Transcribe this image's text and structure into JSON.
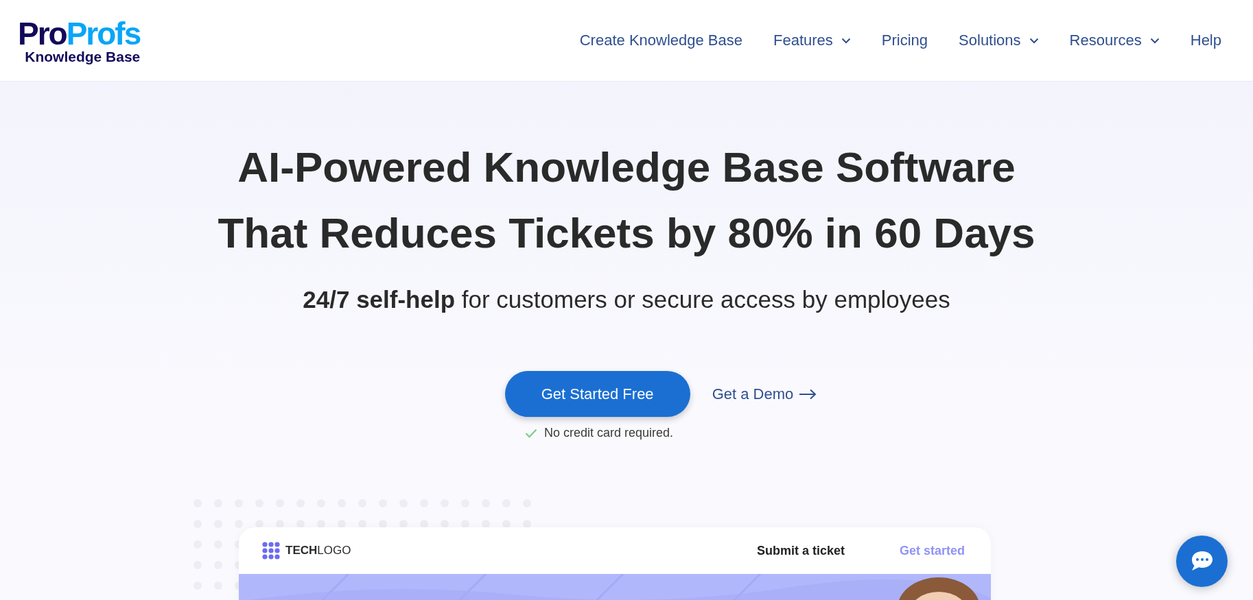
{
  "logo": {
    "part_1": "Pro",
    "part_2": "Profs",
    "subtitle": "Knowledge Base"
  },
  "nav": [
    {
      "label": "Create Knowledge Base",
      "dropdown": false
    },
    {
      "label": "Features",
      "dropdown": true
    },
    {
      "label": "Pricing",
      "dropdown": false
    },
    {
      "label": "Solutions",
      "dropdown": true
    },
    {
      "label": "Resources",
      "dropdown": true
    },
    {
      "label": "Help",
      "dropdown": false
    }
  ],
  "hero": {
    "headline": [
      "AI-Powered Knowledge Base Software",
      "That Reduces Tickets by 80% in 60 Days"
    ],
    "subtitle": "**24/7 self-help** for customers or secure access by employees",
    "primary_button": "Get Started Free",
    "secondary_link": "Get a Demo",
    "note": "No credit card required."
  },
  "mockup": {
    "logo": "**TECH**LOGO",
    "links": [
      "Submit a ticket",
      "Get started"
    ]
  }
}
